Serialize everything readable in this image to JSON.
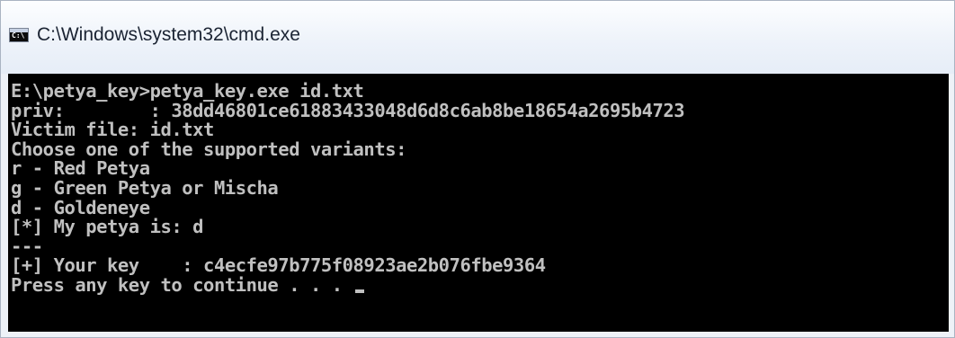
{
  "window": {
    "title": "C:\\Windows\\system32\\cmd.exe",
    "icon_text": "C:\\"
  },
  "console": {
    "lines": [
      "E:\\petya_key>petya_key.exe id.txt",
      "priv:        : 38dd46801ce61883433048d6d8c6ab8be18654a2695b4723",
      "Victim file: id.txt",
      "Choose one of the supported variants:",
      "r - Red Petya",
      "g - Green Petya or Mischa",
      "d - Goldeneye",
      "[*] My petya is: d",
      "---",
      "[+] Your key    : c4ecfe97b775f08923ae2b076fbe9364",
      "Press any key to continue . . . "
    ]
  },
  "colors": {
    "console_bg": "#000000",
    "console_fg": "#c0c0c0",
    "titlebar_bg": "#eef3fa"
  }
}
